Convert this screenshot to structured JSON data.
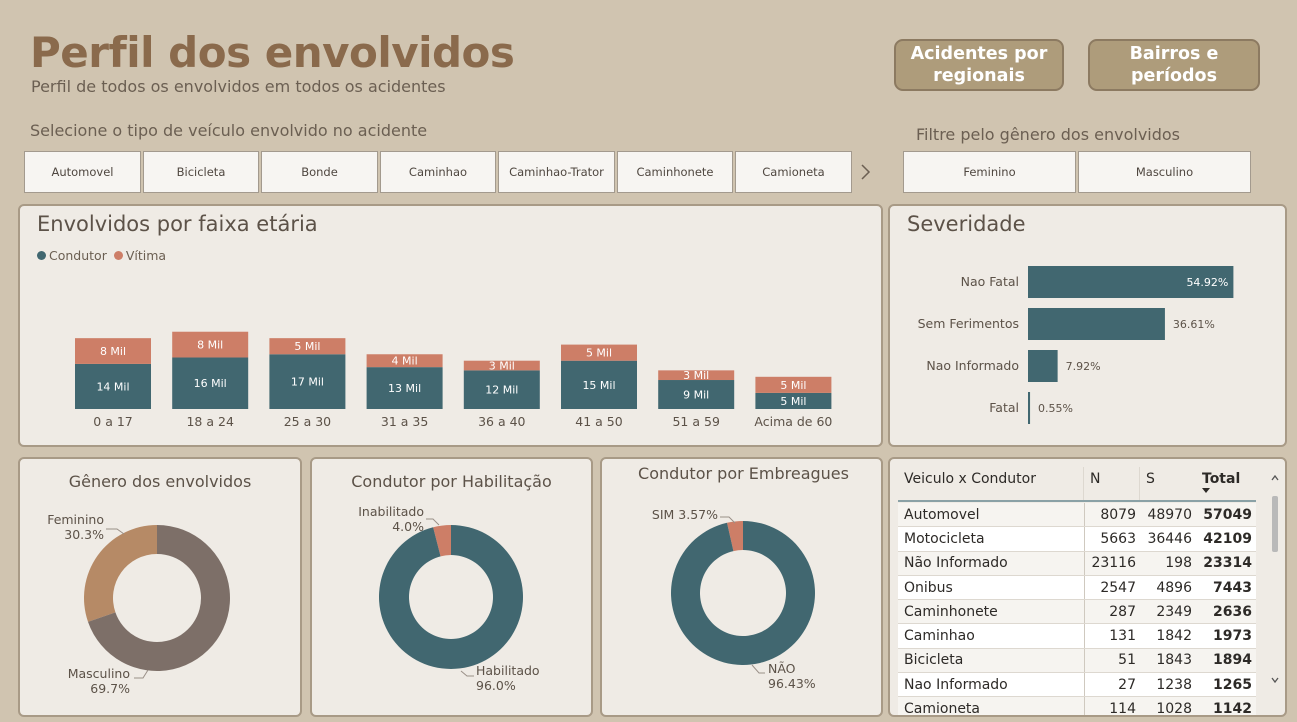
{
  "header": {
    "title": "Perfil dos envolvidos",
    "subtitle": "Perfil de todos os envolvidos em todos os acidentes"
  },
  "nav": {
    "regionais": "Acidentes por regionais",
    "bairros": "Bairros e períodos"
  },
  "vehicle_filter": {
    "label": "Selecione o tipo de veículo envolvido no acidente",
    "options": [
      "Automovel",
      "Bicicleta",
      "Bonde",
      "Caminhao",
      "Caminhao-Trator",
      "Caminhonete",
      "Camioneta"
    ]
  },
  "gender_filter": {
    "label": "Filtre pelo gênero dos envolvidos",
    "options": [
      "Feminino",
      "Masculino"
    ]
  },
  "colors": {
    "teal": "#416770",
    "salmon": "#cd7e67",
    "brown": "#b68a66",
    "grey_brown": "#7d6f68",
    "background": "#d0c4b0",
    "card": "#efebe5"
  },
  "age_chart": {
    "title": "Envolvidos por faixa etária",
    "chart_data": {
      "type": "bar",
      "stacked": true,
      "categories": [
        "0 a 17",
        "18 a 24",
        "25 a 30",
        "31 a 35",
        "36 a 40",
        "41 a 50",
        "51 a 59",
        "Acima de 60"
      ],
      "series": [
        {
          "name": "Condutor",
          "values": [
            14,
            16,
            17,
            13,
            12,
            15,
            9,
            5
          ],
          "labels": [
            "14 Mil",
            "16 Mil",
            "17 Mil",
            "13 Mil",
            "12 Mil",
            "15 Mil",
            "9 Mil",
            "5 Mil"
          ]
        },
        {
          "name": "Vítima",
          "values": [
            8,
            8,
            5,
            4,
            3,
            5,
            3,
            5
          ],
          "labels": [
            "8 Mil",
            "8 Mil",
            "5 Mil",
            "4 Mil",
            "3 Mil",
            "5 Mil",
            "3 Mil",
            "5 Mil"
          ]
        }
      ],
      "legend": "top-left"
    }
  },
  "severity_chart": {
    "title": "Severidade",
    "chart_data": {
      "type": "bar",
      "orientation": "horizontal",
      "categories": [
        "Nao Fatal",
        "Sem Ferimentos",
        "Nao Informado",
        "Fatal"
      ],
      "values": [
        54.92,
        36.61,
        7.92,
        0.55
      ],
      "labels": [
        "54.92%",
        "36.61%",
        "7.92%",
        "0.55%"
      ]
    }
  },
  "gender_chart": {
    "title": "Gênero dos envolvidos",
    "chart_data": {
      "type": "pie",
      "donut": true,
      "categories": [
        "Feminino",
        "Masculino"
      ],
      "values": [
        30.3,
        69.7
      ],
      "labels": [
        "30.3%",
        "69.7%"
      ]
    }
  },
  "license_chart": {
    "title": "Condutor por Habilitação",
    "chart_data": {
      "type": "pie",
      "donut": true,
      "categories": [
        "Inabilitado",
        "Habilitado"
      ],
      "values": [
        4.0,
        96.0
      ],
      "labels": [
        "4.0%",
        "96.0%"
      ]
    }
  },
  "drunk_chart": {
    "title": "Condutor por Embreagues",
    "chart_data": {
      "type": "pie",
      "donut": true,
      "categories": [
        "SIM",
        "NÃO"
      ],
      "values": [
        3.57,
        96.43
      ],
      "labels": [
        "3.57%",
        "96.43%"
      ]
    }
  },
  "matrix": {
    "headers": [
      "Veiculo x Condutor",
      "N",
      "S",
      "Total"
    ],
    "rows": [
      [
        "Automovel",
        "8079",
        "48970",
        "57049"
      ],
      [
        "Motocicleta",
        "5663",
        "36446",
        "42109"
      ],
      [
        "Não Informado",
        "23116",
        "198",
        "23314"
      ],
      [
        "Onibus",
        "2547",
        "4896",
        "7443"
      ],
      [
        "Caminhonete",
        "287",
        "2349",
        "2636"
      ],
      [
        "Caminhao",
        "131",
        "1842",
        "1973"
      ],
      [
        "Bicicleta",
        "51",
        "1843",
        "1894"
      ],
      [
        "Nao Informado",
        "27",
        "1238",
        "1265"
      ],
      [
        "Camioneta",
        "114",
        "1028",
        "1142"
      ]
    ]
  }
}
